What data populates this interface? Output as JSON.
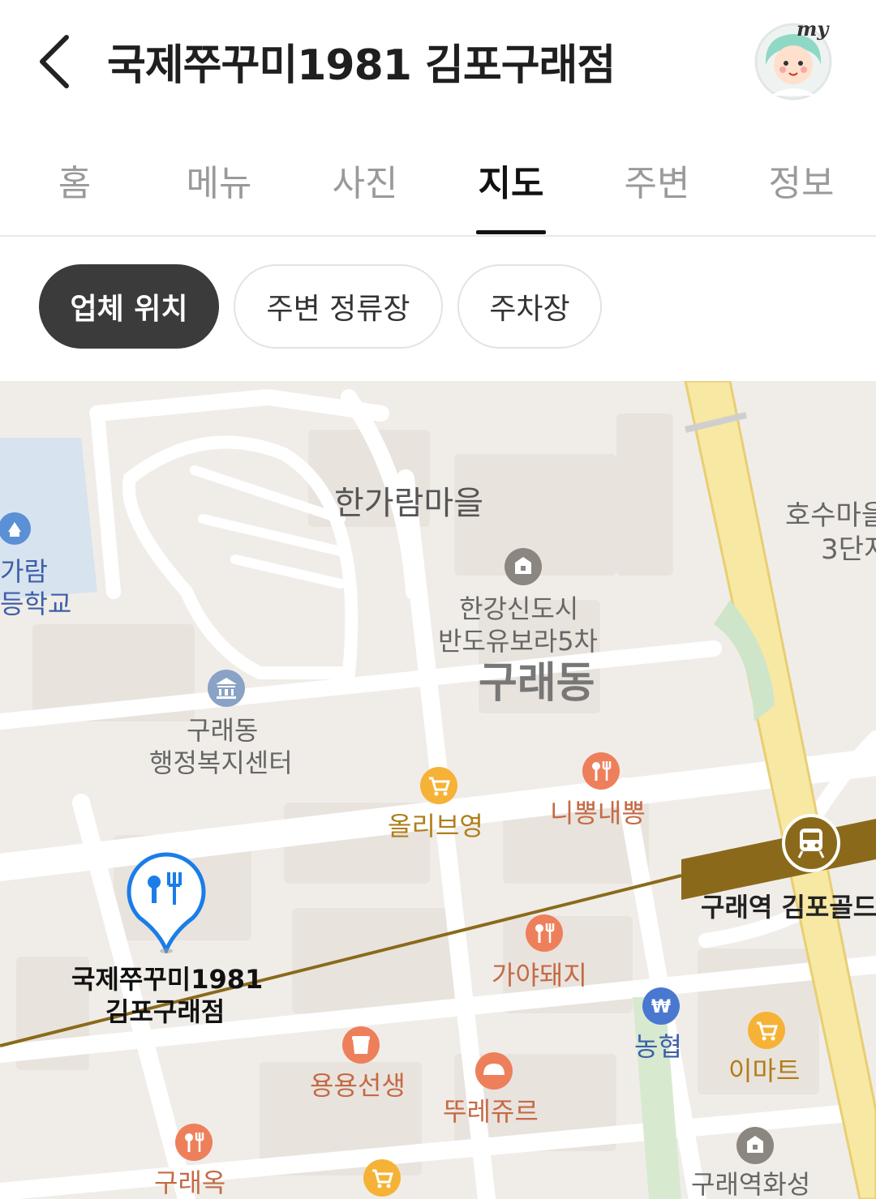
{
  "header": {
    "title": "국제쭈꾸미1981 김포구래점",
    "my_label": "my"
  },
  "tabs": [
    {
      "label": "홈"
    },
    {
      "label": "메뉴"
    },
    {
      "label": "사진"
    },
    {
      "label": "지도",
      "active": true
    },
    {
      "label": "주변"
    },
    {
      "label": "정보"
    }
  ],
  "chips": [
    {
      "label": "업체 위치",
      "active": true
    },
    {
      "label": "주변 정류장"
    },
    {
      "label": "주차장"
    }
  ],
  "map": {
    "area_labels": {
      "hangaram": "한가람마을",
      "hosu_1": "호수마을",
      "hosu_2": "3단지",
      "guraedong": "구래동"
    },
    "pois": {
      "school_1": "가람",
      "school_2": "등학교",
      "apt_1": "한강신도시",
      "apt_2": "반도유보라5차",
      "center_1": "구래동",
      "center_2": "행정복지센터",
      "oliveyoung": "올리브영",
      "nippong": "니뽕내뽕",
      "gaya": "가야돼지",
      "nh": "농협",
      "emart": "이마트",
      "yongyong": "용용선생",
      "tous": "뚜레쥬르",
      "guraeok": "구래옥",
      "hwaseong": "구래역화성",
      "station": "구래역 김포골드"
    },
    "target": {
      "line1": "국제쭈꾸미1981",
      "line2": "김포구래점"
    },
    "colors": {
      "food": "#ee7f5b",
      "shop": "#f5b236",
      "bank": "#4a78d0",
      "pin": "#1a7de8",
      "rail": "#8a6a1a",
      "highway": "#f7e8a4"
    }
  }
}
